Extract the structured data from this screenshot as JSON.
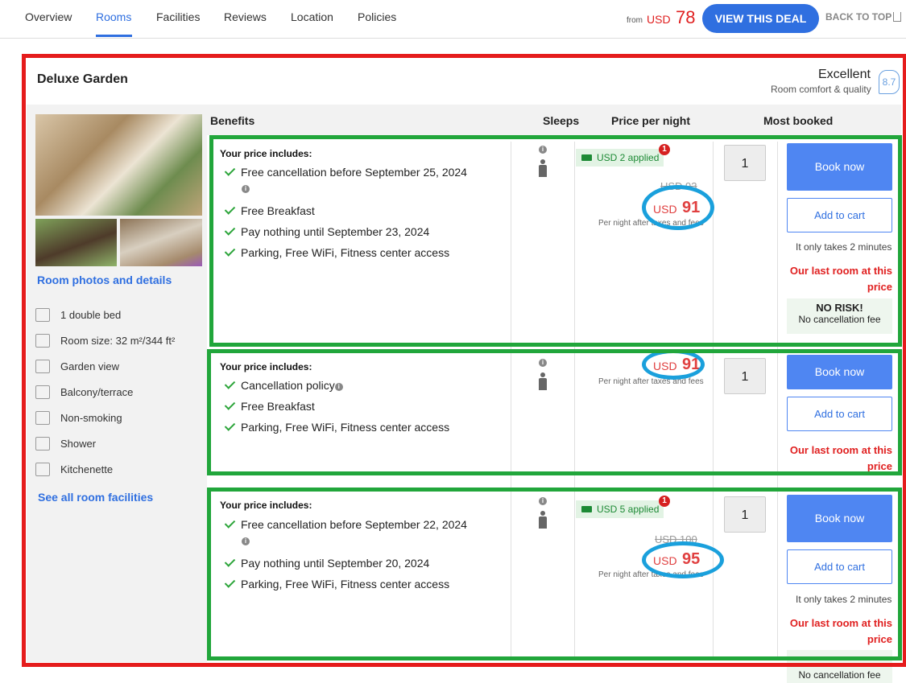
{
  "nav": {
    "tabs": [
      "Overview",
      "Rooms",
      "Facilities",
      "Reviews",
      "Location",
      "Policies"
    ],
    "active_tab": "Rooms",
    "from_label": "from",
    "currency": "USD",
    "from_price": "78",
    "deal_button": "VIEW THIS DEAL",
    "back_to_top": "BACK TO TOP"
  },
  "room": {
    "name": "Deluxe Garden",
    "rating_label": "Excellent",
    "rating_sub": "Room comfort & quality",
    "rating_score": "8.7",
    "photos_link": "Room photos and details",
    "facilities": [
      {
        "label": "1 double bed",
        "icon": "bed-icon"
      },
      {
        "label": "Room size: 32 m²/344 ft²",
        "icon": "room-size-icon"
      },
      {
        "label": "Garden view",
        "icon": "garden-view-icon"
      },
      {
        "label": "Balcony/terrace",
        "icon": "balcony-icon"
      },
      {
        "label": "Non-smoking",
        "icon": "non-smoking-icon"
      },
      {
        "label": "Shower",
        "icon": "shower-icon"
      },
      {
        "label": "Kitchenette",
        "icon": "kitchenette-icon"
      }
    ],
    "all_facilities_link": "See all room facilities"
  },
  "table_headers": {
    "benefits": "Benefits",
    "sleeps": "Sleeps",
    "price": "Price per night",
    "most_booked": "Most booked"
  },
  "offers": [
    {
      "includes_label": "Your price includes:",
      "benefits": [
        "Free cancellation before September 25, 2024",
        "Free Breakfast",
        "Pay nothing until September 23, 2024",
        "Parking, Free WiFi, Fitness center access"
      ],
      "applied": "USD 2 applied",
      "badge": "1",
      "old_price": "USD 93",
      "currency": "USD",
      "price": "91",
      "per_night": "Per night after taxes and fees",
      "qty": "1",
      "book": "Book now",
      "cart": "Add to cart",
      "takes": "It only takes 2 minutes",
      "last_room": "Our last room at this price",
      "no_risk": "NO RISK!",
      "no_cancel": "No cancellation fee"
    },
    {
      "includes_label": "Your price includes:",
      "benefits": [
        "Cancellation policy",
        "Free Breakfast",
        "Parking, Free WiFi, Fitness center access"
      ],
      "currency": "USD",
      "price": "91",
      "per_night": "Per night after taxes and fees",
      "qty": "1",
      "book": "Book now",
      "cart": "Add to cart",
      "last_room": "Our last room at this price"
    },
    {
      "includes_label": "Your price includes:",
      "benefits": [
        "Free cancellation before September 22, 2024",
        "Pay nothing until September 20, 2024",
        "Parking, Free WiFi, Fitness center access"
      ],
      "applied": "USD 5 applied",
      "badge": "1",
      "old_price": "USD 100",
      "currency": "USD",
      "price": "95",
      "per_night": "Per night after taxes and fees",
      "qty": "1",
      "book": "Book now",
      "cart": "Add to cart",
      "takes": "It only takes 2 minutes",
      "last_room": "Our last room at this price",
      "no_cancel": "No cancellation fee"
    }
  ],
  "colors": {
    "accent": "#2f6fe0",
    "price_red": "#e02020",
    "annot_red": "#e51c1c",
    "annot_green": "#21a63b",
    "annot_blue": "#1aa0dc"
  }
}
